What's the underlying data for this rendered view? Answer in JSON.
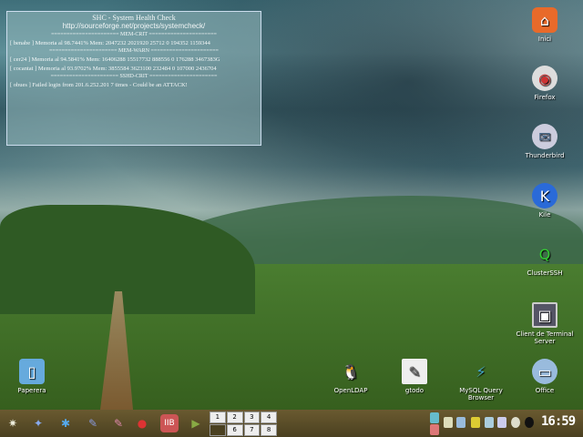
{
  "shc": {
    "title": "SHC - System Health Check",
    "url": "http://sourceforge.net/projects/systemcheck/",
    "sections": [
      {
        "header": "MEM-CRIT",
        "rows": [
          "[ benabe    ]  Memoria al 98.7441%  Mem:  2047232 2021920 25712 0 194352 1159344"
        ]
      },
      {
        "header": "MEM-WARN",
        "rows": [
          "[ cer24      ]  Memoria al 94.5841%  Mem:  16406288 15517732 888556 0 176288 3467383G",
          "[ cocantat  ]  Memoria al 93.9702%  Mem:  3855584 3623100 232484 0 107000 2436704"
        ]
      },
      {
        "header": "SSHD-CRIT",
        "rows": [
          "[ obues     ]  Failed login from 201.6.252.201 7 times - Could be an ATTACK!"
        ]
      }
    ]
  },
  "desktop_icons": [
    {
      "label": "Inici",
      "icon": "home-icon"
    },
    {
      "label": "Firefox",
      "icon": "firefox-icon"
    },
    {
      "label": "Thunderbird",
      "icon": "thunderbird-icon"
    },
    {
      "label": "Kile",
      "icon": "kile-icon"
    },
    {
      "label": "ClusterSSH",
      "icon": "clusterssh-icon"
    },
    {
      "label": "Client de Terminal Server",
      "icon": "terminal-server-icon"
    },
    {
      "label": "Paperera",
      "icon": "trash-icon"
    },
    {
      "label": "OpenLDAP",
      "icon": "penguin-icon"
    },
    {
      "label": "gtodo",
      "icon": "todo-icon"
    },
    {
      "label": "MySQL Query Browser",
      "icon": "mysql-icon"
    },
    {
      "label": "Office",
      "icon": "office-icon"
    }
  ],
  "taskbar": {
    "pager": [
      "1",
      "2",
      "3",
      "4",
      "",
      "6",
      "7",
      "8"
    ],
    "active_desktop": "5",
    "clock": "16:59"
  }
}
